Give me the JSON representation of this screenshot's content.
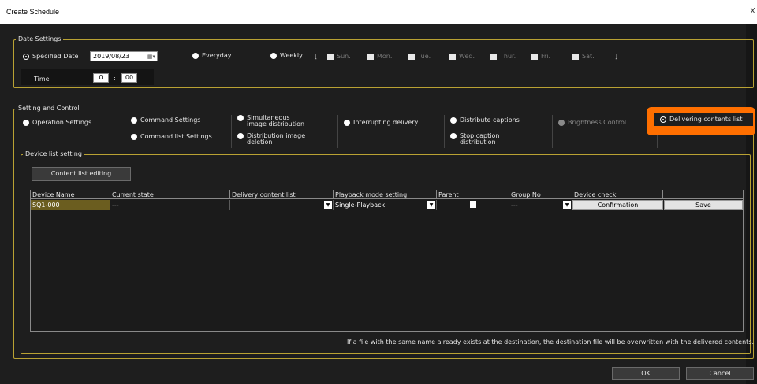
{
  "window": {
    "title": "Create Schedule",
    "close_glyph": "X"
  },
  "date_settings": {
    "legend": "Date Settings",
    "specified_date_label": "Specified Date",
    "date_value": "2019/08/23",
    "everyday_label": "Everyday",
    "weekly_label": "Weekly",
    "bracket_open": "[",
    "bracket_close": "]",
    "days": [
      "Sun.",
      "Mon.",
      "Tue.",
      "Wed.",
      "Thur.",
      "Fri.",
      "Sat."
    ],
    "time_label": "Time",
    "time_hour": "0",
    "time_sep": ":",
    "time_minute": "00"
  },
  "setting_control": {
    "legend": "Setting and Control",
    "operation_settings": "Operation Settings",
    "command_settings": "Command Settings",
    "command_list_settings": "Command list Settings",
    "simultaneous_distribution": "Simultaneous\nimage distribution",
    "distribution_deletion": "Distribution image\ndeletion",
    "interrupting_delivery": "Interrupting delivery",
    "distribute_captions": "Distribute captions",
    "stop_caption": "Stop caption\ndistribution",
    "brightness_control": "Brightness Control",
    "delivering_contents_list": "Delivering contents list"
  },
  "device_list": {
    "legend": "Device list setting",
    "content_list_editing": "Content list editing",
    "columns": [
      "Device Name",
      "Current state",
      "Delivery content list",
      "Playback mode setting",
      "Parent",
      "Group No",
      "Device check"
    ],
    "row": {
      "device_name": "SQ1-000",
      "current_state": "---",
      "delivery_content_list": "",
      "playback_mode": "Single-Playback",
      "group_no": "---",
      "confirmation": "Confirmation",
      "save": "Save"
    },
    "note": "If a file with the same name already exists at the destination, the destination file will be overwritten with the delivered contents."
  },
  "footer": {
    "ok": "OK",
    "cancel": "Cancel"
  },
  "colors": {
    "accent_highlight": "#ff6f00",
    "group_border": "#b9a233",
    "selected_row": "#6b5d1f"
  }
}
